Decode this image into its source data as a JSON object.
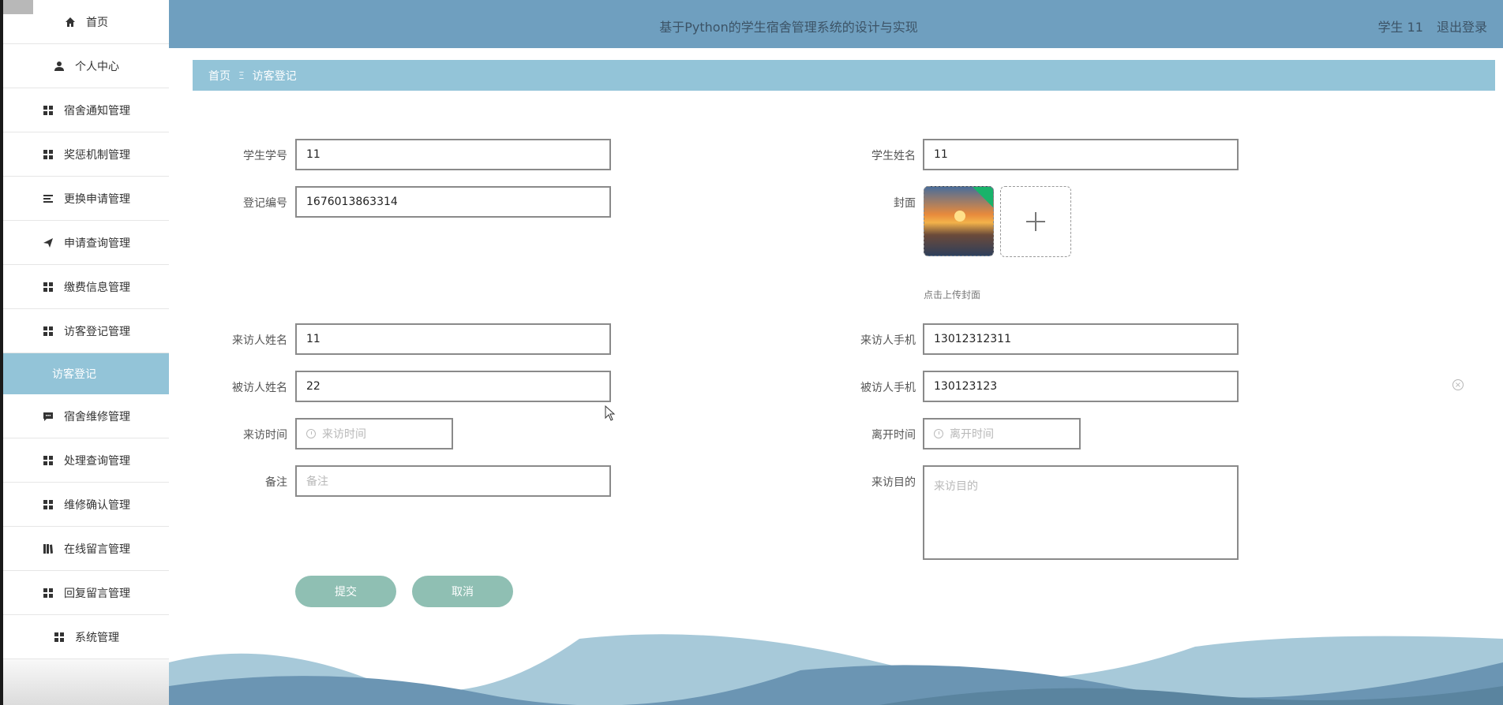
{
  "header": {
    "title": "基于Python的学生宿舍管理系统的设计与实现",
    "user_label": "学生 11",
    "logout_label": "退出登录"
  },
  "sidebar": {
    "items": [
      {
        "label": "首页",
        "icon": "home-icon"
      },
      {
        "label": "个人中心",
        "icon": "user-icon"
      },
      {
        "label": "宿舍通知管理",
        "icon": "grid-icon"
      },
      {
        "label": "奖惩机制管理",
        "icon": "grid-icon"
      },
      {
        "label": "更换申请管理",
        "icon": "list-icon"
      },
      {
        "label": "申请查询管理",
        "icon": "send-icon"
      },
      {
        "label": "缴费信息管理",
        "icon": "grid-icon"
      },
      {
        "label": "访客登记管理",
        "icon": "grid-icon"
      },
      {
        "label": "访客登记",
        "icon": "",
        "active": true
      },
      {
        "label": "宿舍维修管理",
        "icon": "chat-icon"
      },
      {
        "label": "处理查询管理",
        "icon": "grid-icon"
      },
      {
        "label": "维修确认管理",
        "icon": "grid-icon"
      },
      {
        "label": "在线留言管理",
        "icon": "book-icon"
      },
      {
        "label": "回复留言管理",
        "icon": "grid-icon"
      },
      {
        "label": "系统管理",
        "icon": "grid-icon"
      }
    ]
  },
  "breadcrumb": {
    "home": "首页",
    "separator": "Ξ",
    "current": "访客登记"
  },
  "form": {
    "student_no": {
      "label": "学生学号",
      "value": "11"
    },
    "student_name": {
      "label": "学生姓名",
      "value": "11"
    },
    "reg_no": {
      "label": "登记编号",
      "value": "1676013863314"
    },
    "cover": {
      "label": "封面",
      "hint": "点击上传封面"
    },
    "visitor_name": {
      "label": "来访人姓名",
      "value": "11"
    },
    "visitor_phone": {
      "label": "来访人手机",
      "value": "13012312311"
    },
    "visited_name": {
      "label": "被访人姓名",
      "value": "22"
    },
    "visited_phone": {
      "label": "被访人手机",
      "value": "130123123"
    },
    "visit_time": {
      "label": "来访时间",
      "placeholder": "来访时间"
    },
    "leave_time": {
      "label": "离开时间",
      "placeholder": "离开时间"
    },
    "remark": {
      "label": "备注",
      "placeholder": "备注"
    },
    "purpose": {
      "label": "来访目的",
      "placeholder": "来访目的"
    }
  },
  "buttons": {
    "submit": "提交",
    "cancel": "取消"
  },
  "colors": {
    "header_bg": "#6f9fbf",
    "accent": "#93c4d8",
    "button": "#8fbfb3"
  }
}
